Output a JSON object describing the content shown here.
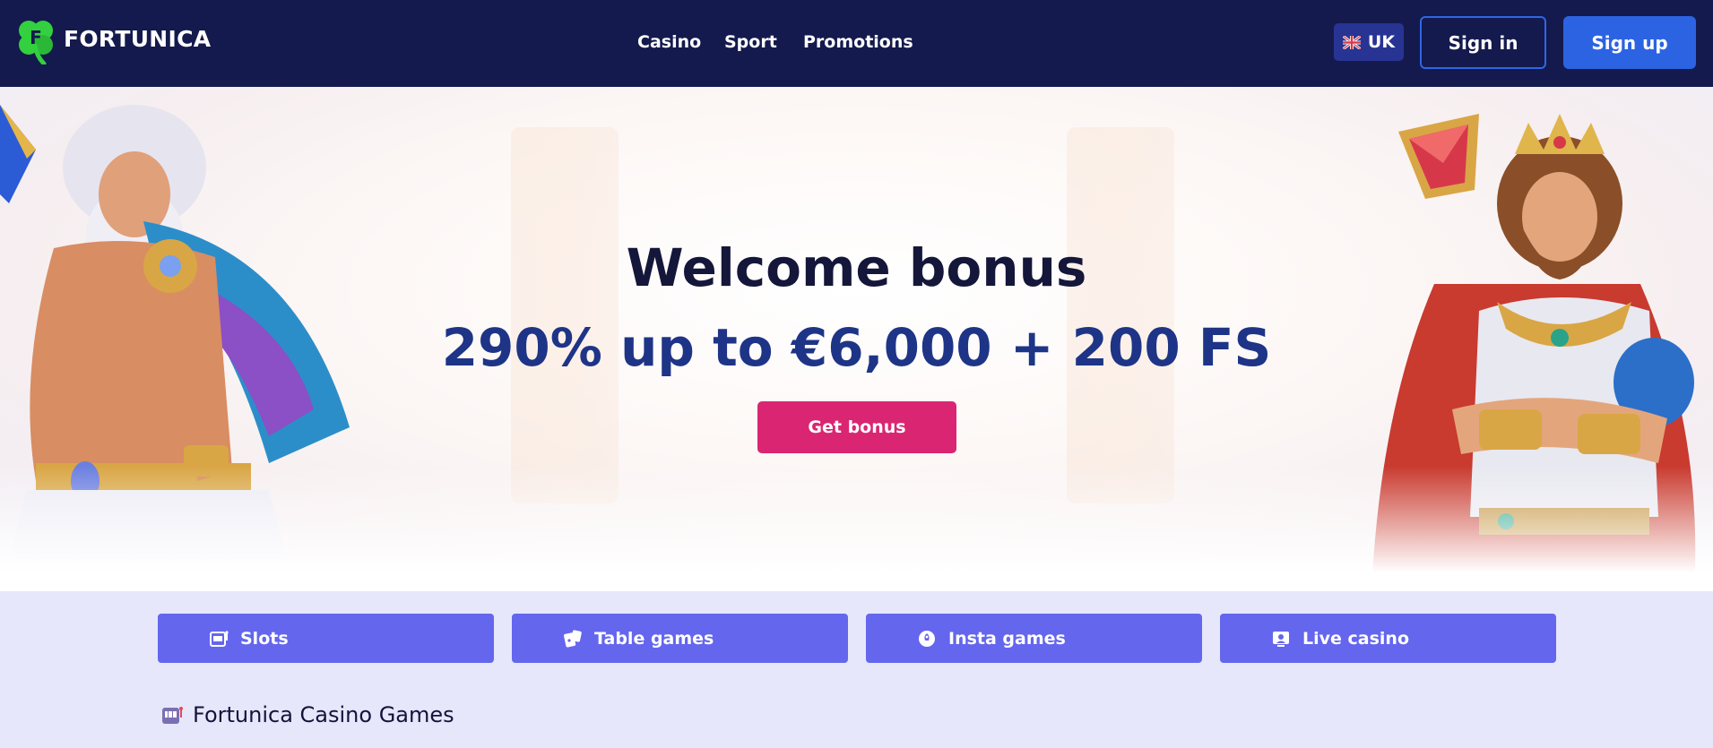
{
  "header": {
    "brand": "FORTUNICA",
    "logo_icon": "clover-logo-icon",
    "nav": [
      {
        "label": "Casino"
      },
      {
        "label": "Sport"
      },
      {
        "label": "Promotions"
      }
    ],
    "language": {
      "code": "UK",
      "flag_icon": "uk-flag-icon"
    },
    "signin_label": "Sign in",
    "signup_label": "Sign up"
  },
  "hero": {
    "title": "Welcome bonus",
    "offer": "290% up to €6,000 + 200 FS",
    "cta_label": "Get bonus"
  },
  "categories": [
    {
      "label": "Slots",
      "icon": "slot-machine-icon"
    },
    {
      "label": "Table games",
      "icon": "cards-icon"
    },
    {
      "label": "Insta games",
      "icon": "rocket-icon"
    },
    {
      "label": "Live casino",
      "icon": "live-dealer-icon"
    }
  ],
  "section": {
    "title": "Fortunica Casino Games",
    "icon": "slot-machine-icon"
  },
  "colors": {
    "header_bg": "#141a4d",
    "accent_blue": "#2b63e2",
    "cta_pink": "#da2672",
    "category_purple": "#6466ee",
    "page_bg": "#e6e7fb"
  }
}
